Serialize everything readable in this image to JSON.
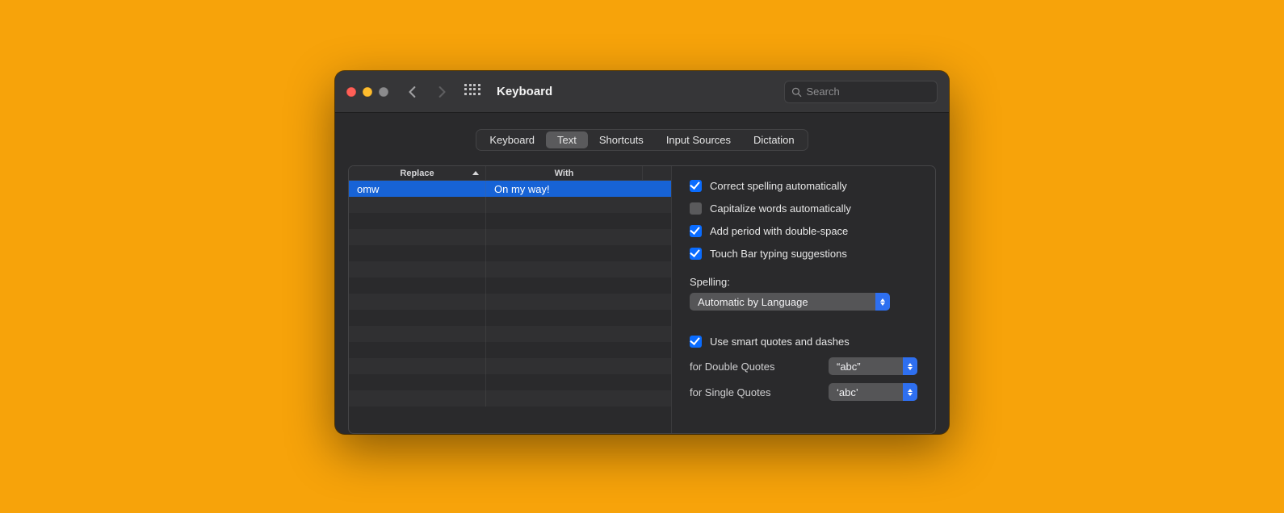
{
  "window": {
    "title": "Keyboard"
  },
  "search": {
    "placeholder": "Search"
  },
  "tabs": [
    "Keyboard",
    "Text",
    "Shortcuts",
    "Input Sources",
    "Dictation"
  ],
  "tab_active_index": 1,
  "table": {
    "headers": {
      "replace": "Replace",
      "with": "With"
    },
    "rows": [
      {
        "replace": "omw",
        "with": "On my way!",
        "selected": true
      }
    ],
    "empty_row_count": 13
  },
  "checkboxes": {
    "correct_spelling": {
      "label": "Correct spelling automatically",
      "checked": true
    },
    "capitalize_words": {
      "label": "Capitalize words automatically",
      "checked": false
    },
    "double_space_period": {
      "label": "Add period with double-space",
      "checked": true
    },
    "touch_bar_suggestions": {
      "label": "Touch Bar typing suggestions",
      "checked": true
    },
    "smart_quotes": {
      "label": "Use smart quotes and dashes",
      "checked": true
    }
  },
  "spelling": {
    "label": "Spelling:",
    "value": "Automatic by Language"
  },
  "quotes": {
    "double": {
      "label": "for Double Quotes",
      "value": "“abc”"
    },
    "single": {
      "label": "for Single Quotes",
      "value": "‘abc’"
    }
  }
}
